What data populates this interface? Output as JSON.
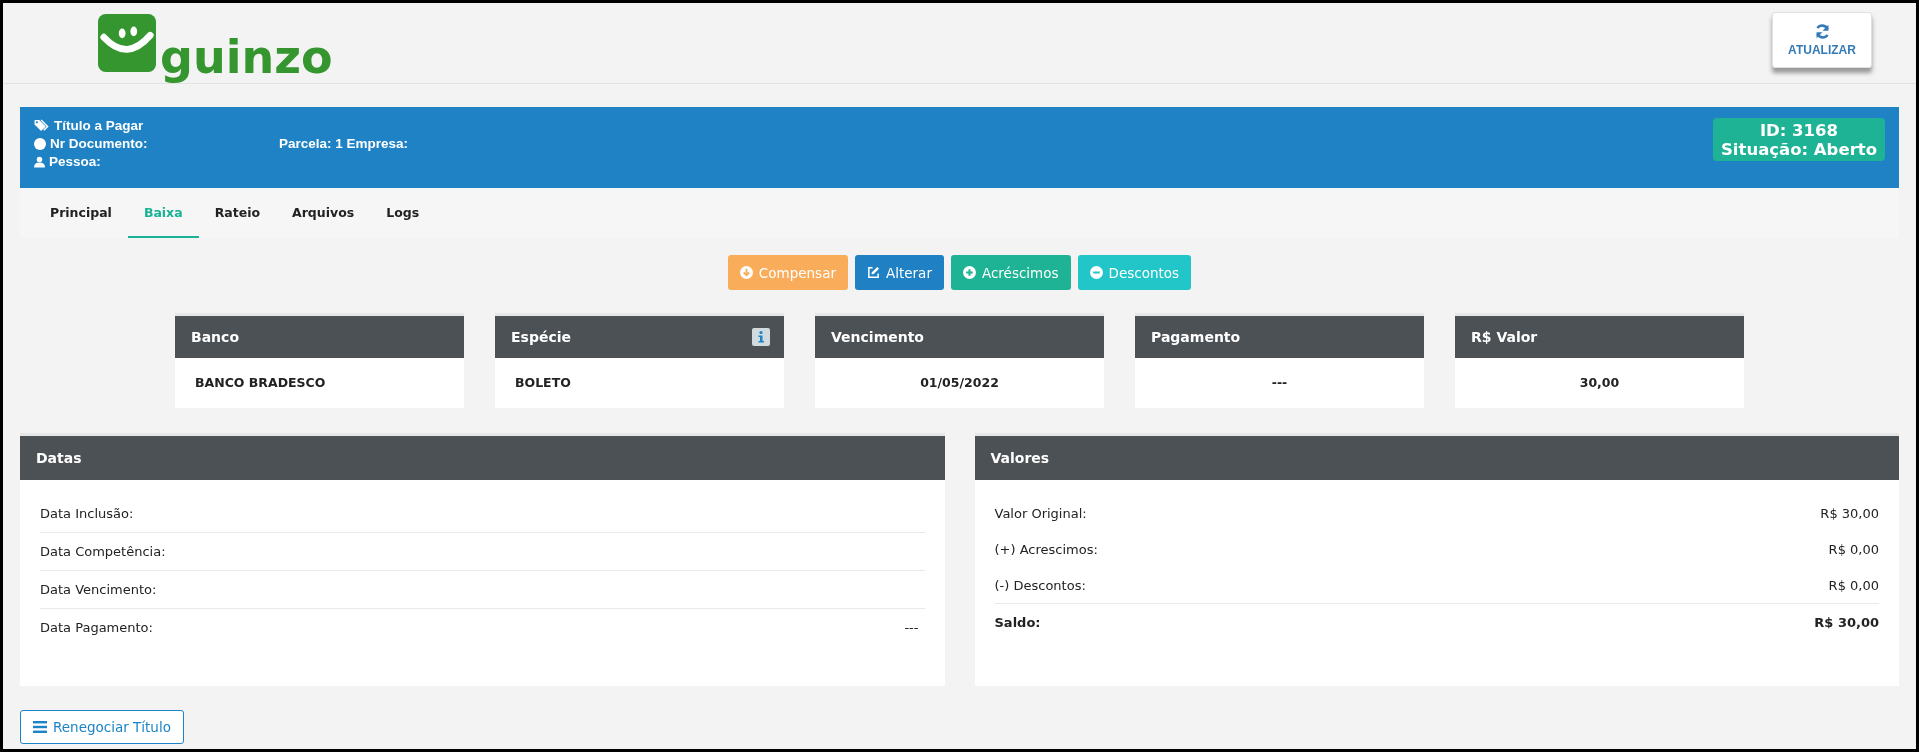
{
  "logo": {
    "text": "guinzo"
  },
  "refresh_button": {
    "label": "ATUALIZAR"
  },
  "title_bar": {
    "title": "Título a Pagar",
    "document": "Nr Documento:",
    "parcela": "Parcela: 1 Empresa:",
    "person": "Pessoa:",
    "id": "ID: 3168",
    "status": "Situação: Aberto"
  },
  "tabs": [
    {
      "label": "Principal",
      "selected": false
    },
    {
      "label": "Baixa",
      "selected": true
    },
    {
      "label": "Rateio",
      "selected": false
    },
    {
      "label": "Arquivos",
      "selected": false
    },
    {
      "label": "Logs",
      "selected": false
    }
  ],
  "actions": [
    {
      "label": "Compensar",
      "kind": "down",
      "color": "#f9ad5a"
    },
    {
      "label": "Alterar",
      "kind": "edit",
      "color": "#1f81c4"
    },
    {
      "label": "Acréscimos",
      "kind": "plus",
      "color": "#1db394"
    },
    {
      "label": "Descontos",
      "kind": "minus",
      "color": "#23c6c8"
    }
  ],
  "cards": [
    {
      "title": "Banco",
      "value": "BANCO BRADESCO",
      "kind": "text",
      "info": false
    },
    {
      "title": "Espécie",
      "value": "BOLETO",
      "kind": "text",
      "info": true
    },
    {
      "title": "Vencimento",
      "value": "01/05/2022",
      "kind": "figure",
      "info": false
    },
    {
      "title": "Pagamento",
      "value": "---",
      "kind": "figure",
      "info": false
    },
    {
      "title": "R$ Valor",
      "value": "30,00",
      "kind": "figure",
      "info": false
    }
  ],
  "datas": {
    "title": "Datas",
    "rows": [
      {
        "label": "Data Inclusão:"
      },
      {
        "label": "Data Competência:"
      },
      {
        "label": "Data Vencimento:"
      },
      {
        "label": "Data Pagamento:",
        "value": "---"
      }
    ]
  },
  "valores": {
    "title": "Valores",
    "rows": [
      {
        "label": "Valor Original:",
        "value": "R$ 30,00",
        "kind": "item"
      },
      {
        "label": "(+) Acrescimos:",
        "value": "R$ 0,00",
        "kind": "item"
      },
      {
        "label": "(-) Descontos:",
        "value": "R$ 0,00",
        "kind": "item"
      },
      {
        "label": "Saldo:",
        "value": "R$ 30,00",
        "kind": "total"
      }
    ]
  },
  "renegotiate_button": {
    "label": "Renegociar Título"
  }
}
